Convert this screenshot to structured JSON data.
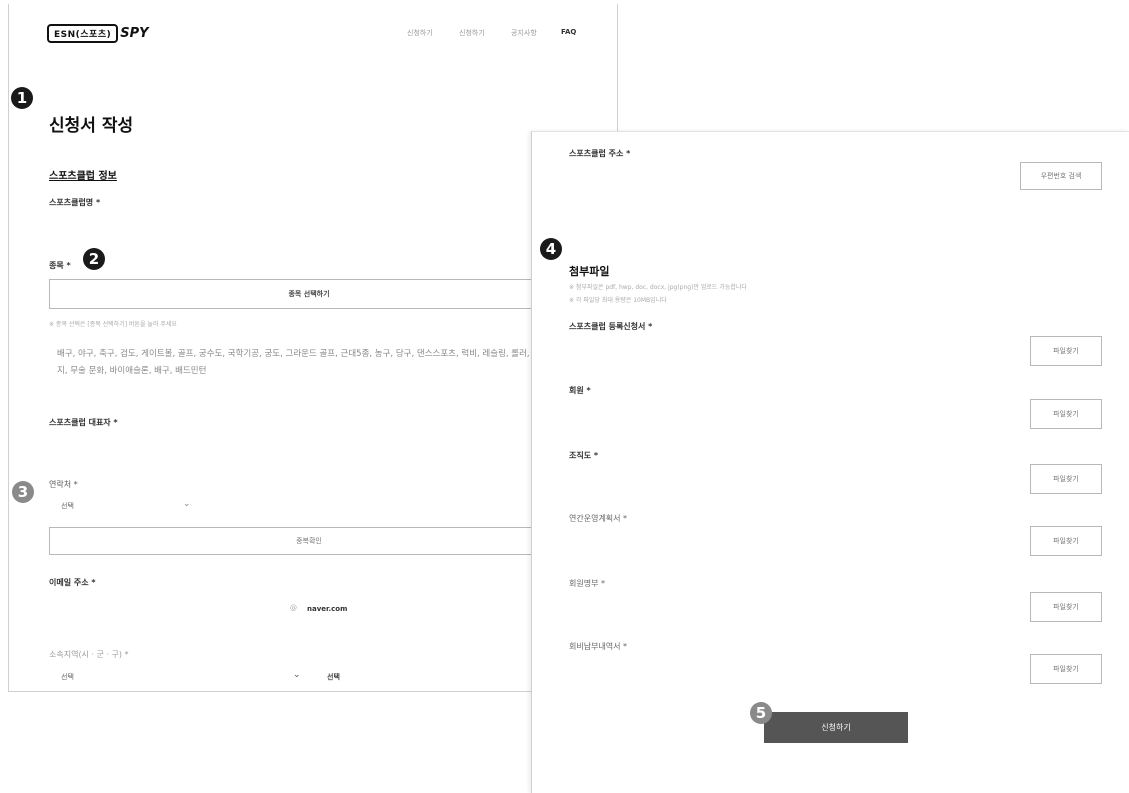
{
  "header": {
    "logo_box": "ESN(스포츠)",
    "logo_text": "SPY",
    "nav": [
      "신청하기",
      "신청하기",
      "공지사항",
      "FAQ"
    ]
  },
  "steps": [
    "1",
    "2",
    "3",
    "4",
    "5"
  ],
  "form": {
    "page_title": "신청서 작성",
    "section_title": "스포츠클럽 정보",
    "club_name_label": "스포츠클럽명 *",
    "sport_label": "종목 *",
    "sport_button": "종목 선택하기",
    "sport_hint": "※ 종목 선택은 [종목 선택하기] 버튼을 눌러 주세요",
    "sport_list": "배구, 야구, 축구, 검도, 게이트볼, 골프, 궁수도, 국학기공, 궁도, 그라운드 골프, 근대5종, 농구, 당구, 댄스스포츠, 럭비, 레슬링, 롤러, 루지, 무술 문화, 바이애슬론, 배구, 배드민턴",
    "representative_label": "스포츠클럽 대표자 *",
    "contact_label": "연락처 *",
    "contact_select": "선택",
    "verify_button": "중복확인",
    "email_label": "이메일 주소 *",
    "email_at": "@",
    "email_domain": "naver.com",
    "region_label": "소속지역(시 · 군 · 구) *",
    "region_select": "선택",
    "region_select2": "선택"
  },
  "right": {
    "address_label": "스포츠클럽 주소 *",
    "postcode_button": "우편번호 검색",
    "attach_title": "첨부파일",
    "attach_note1": "※ 첨부파일은 pdf, hwp, doc, docx, jpg(png)만 업로드 가능합니다",
    "attach_note2": "※ 각 파일당 최대 용량은 10MB입니다",
    "files": [
      {
        "label": "스포츠클럽 등록신청서 *",
        "button": "파일찾기"
      },
      {
        "label": "회원 *",
        "button": "파일찾기"
      },
      {
        "label": "조직도 *",
        "button": "파일찾기"
      },
      {
        "label": "연간운영계획서 *",
        "button": "파일찾기"
      },
      {
        "label": "회원명부 *",
        "button": "파일찾기"
      },
      {
        "label": "회비납부내역서 *",
        "button": "파일찾기"
      }
    ],
    "submit_button": "신청하기"
  },
  "colors": {
    "badge_dark": "#1a1a1a",
    "badge_gray": "#8a8a8a",
    "submit_bg": "#555555"
  }
}
